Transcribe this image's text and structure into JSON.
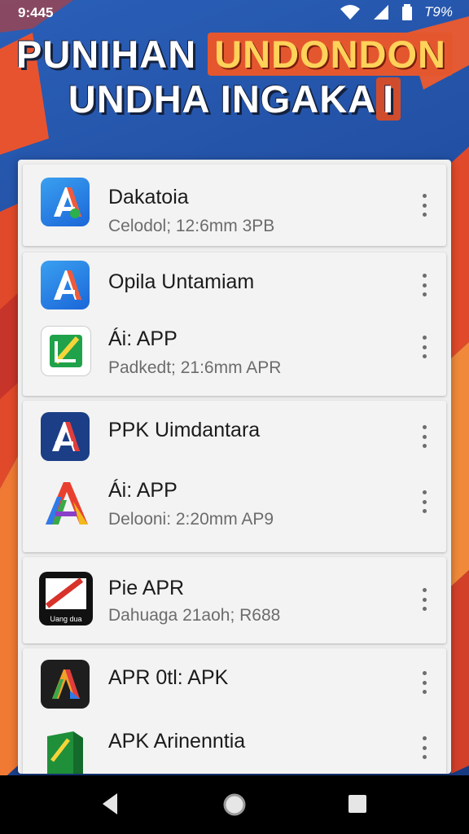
{
  "status": {
    "time": "9:445",
    "battery_text": "T9%"
  },
  "headline": {
    "line1_white": "PUNIHAN",
    "line1_highlight": "UNDONDON",
    "line2_white": "UNDHA INGAKA",
    "line2_highlight": "I"
  },
  "apps": [
    {
      "title": "Dakatoia",
      "subtitle": "Celodol; 12:6mm 3PB",
      "icon": "blue-a-app-icon"
    },
    {
      "title": "Opila Untamiam",
      "subtitle": "",
      "icon": "blue-a-app-icon"
    },
    {
      "title": "Ái: APP",
      "subtitle": "Padkedt; 21:6mm APR",
      "icon": "green-pen-app-icon"
    },
    {
      "title": "PPK Uimdantara",
      "subtitle": "",
      "icon": "dark-blue-a-app-icon"
    },
    {
      "title": "Ái: APP",
      "subtitle": "Delooni: 2:20mm AP9",
      "icon": "rainbow-a-app-icon"
    },
    {
      "title": "Pie APR",
      "subtitle": "Dahuaga 21aoh; R688",
      "icon": "red-pen-app-icon",
      "icon_caption": "Uang dua"
    },
    {
      "title": "APR 0tl: APK",
      "subtitle": "",
      "icon": "dark-a-app-icon"
    },
    {
      "title": "APK  Arinenntia",
      "subtitle": "",
      "icon": "green-book-app-icon"
    }
  ],
  "colors": {
    "brand_blue": "#1f4fa0",
    "highlight_orange": "#e4572e",
    "panel_bg": "#efefef"
  }
}
